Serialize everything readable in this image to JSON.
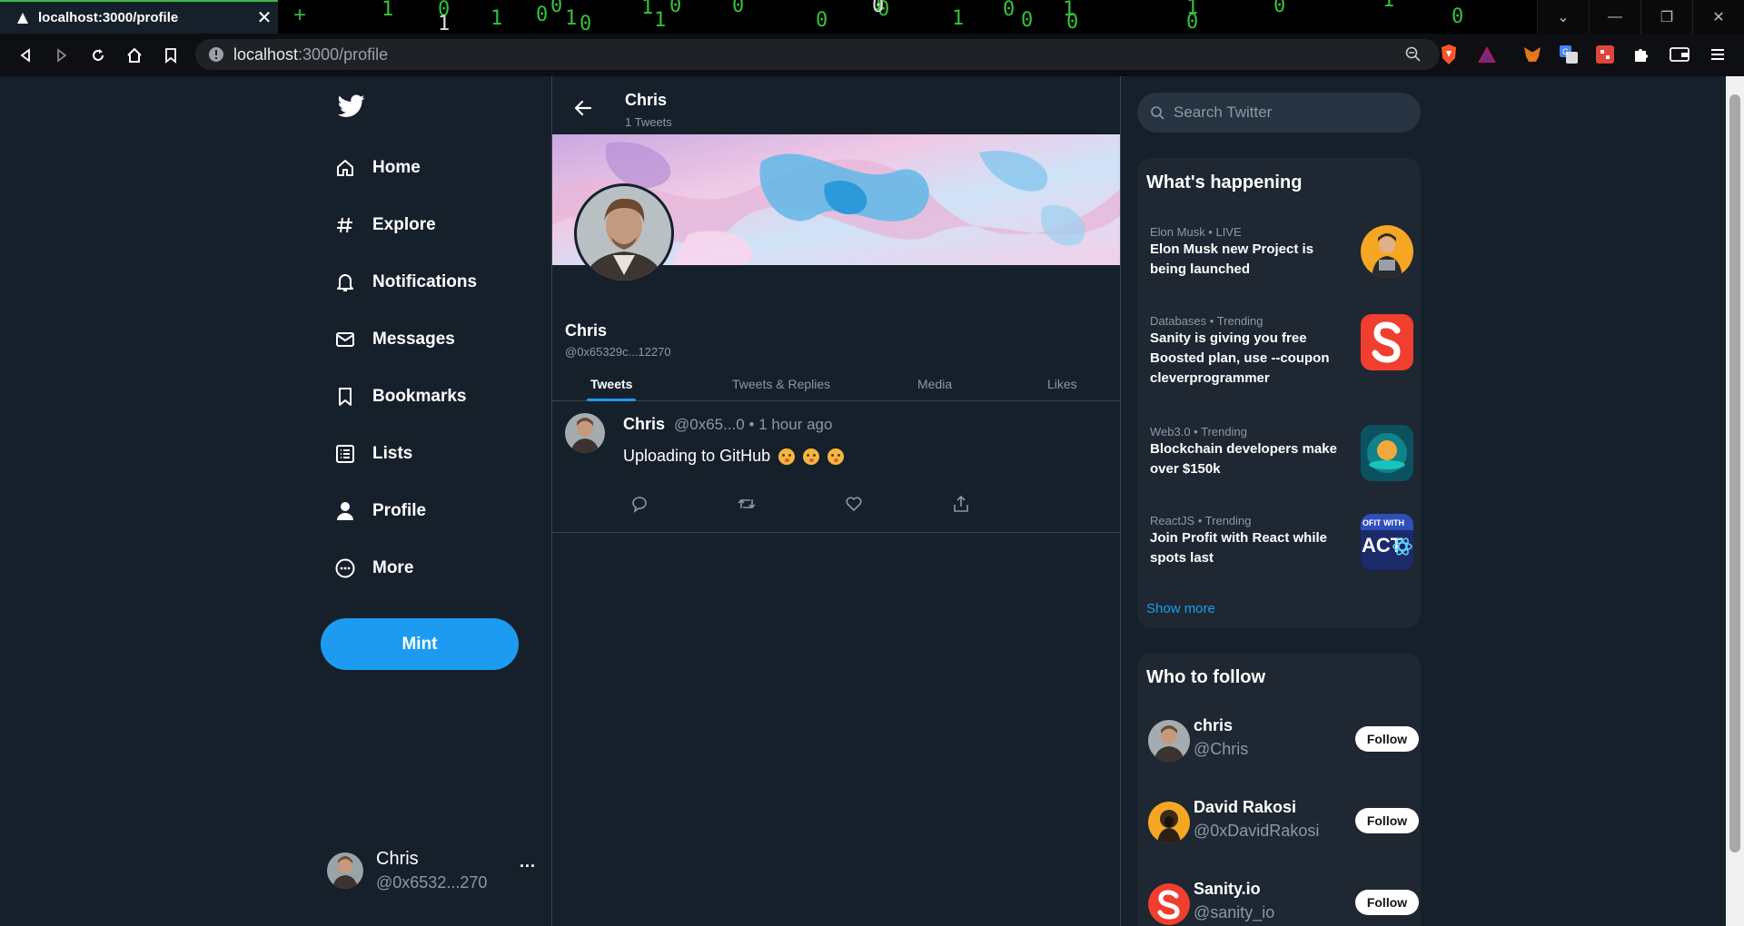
{
  "browser": {
    "tab_title": "localhost:3000/profile",
    "tab_close": "✕",
    "new_tab": "+",
    "matrix_chars": [
      "1",
      "0",
      "1",
      "0",
      "0",
      "1",
      "0",
      "1",
      "1",
      "0",
      "0",
      "0",
      "1",
      "0",
      "1",
      "0",
      "0",
      "1",
      "0",
      "1",
      "0",
      "0",
      "1",
      "0",
      "1",
      "0"
    ],
    "url_host": "localhost",
    "url_path": ":3000/profile"
  },
  "sidebar": {
    "items": [
      {
        "label": "Home",
        "icon": "home-icon"
      },
      {
        "label": "Explore",
        "icon": "hashtag-icon"
      },
      {
        "label": "Notifications",
        "icon": "bell-icon"
      },
      {
        "label": "Messages",
        "icon": "envelope-icon"
      },
      {
        "label": "Bookmarks",
        "icon": "bookmark-icon"
      },
      {
        "label": "Lists",
        "icon": "list-icon"
      },
      {
        "label": "Profile",
        "icon": "person-icon"
      },
      {
        "label": "More",
        "icon": "more-circle-icon"
      }
    ],
    "mint_label": "Mint",
    "me_name": "Chris",
    "me_handle": "@0x6532...270",
    "me_more": "..."
  },
  "profile": {
    "header_name": "Chris",
    "tweet_count": "1 Tweets",
    "name": "Chris",
    "handle": "@0x65329c...12270",
    "tabs": [
      "Tweets",
      "Tweets & Replies",
      "Media",
      "Likes"
    ],
    "active_tab": "Tweets"
  },
  "tweet": {
    "name": "Chris",
    "meta": "@0x65...0 • 1 hour ago",
    "text": "Uploading to GitHub"
  },
  "right": {
    "search_placeholder": "Search Twitter",
    "happening_title": "What's happening",
    "trends": [
      {
        "meta": "Elon Musk • LIVE",
        "title": "Elon Musk new Project is being launched"
      },
      {
        "meta": "Databases • Trending",
        "title": "Sanity is giving you free Boosted plan, use --coupon cleverprogrammer"
      },
      {
        "meta": "Web3.0 • Trending",
        "title": "Blockchain developers make over $150k"
      },
      {
        "meta": "ReactJS • Trending",
        "title": "Join Profit with React while spots last"
      }
    ],
    "react_thumb_text_top": "OFIT WITH",
    "react_thumb_text_big": "ACT",
    "show_more": "Show more",
    "follow_title": "Who to follow",
    "follow": [
      {
        "name": "chris",
        "handle": "@Chris",
        "button": "Follow"
      },
      {
        "name": "David Rakosi",
        "handle": "@0xDavidRakosi",
        "button": "Follow"
      },
      {
        "name": "Sanity.io",
        "handle": "@sanity_io",
        "button": "Follow"
      }
    ]
  },
  "colors": {
    "background": "#15202b",
    "accent": "#1d9bf0",
    "card": "#1e2732",
    "border": "#38444d",
    "muted": "#8b98a5"
  }
}
